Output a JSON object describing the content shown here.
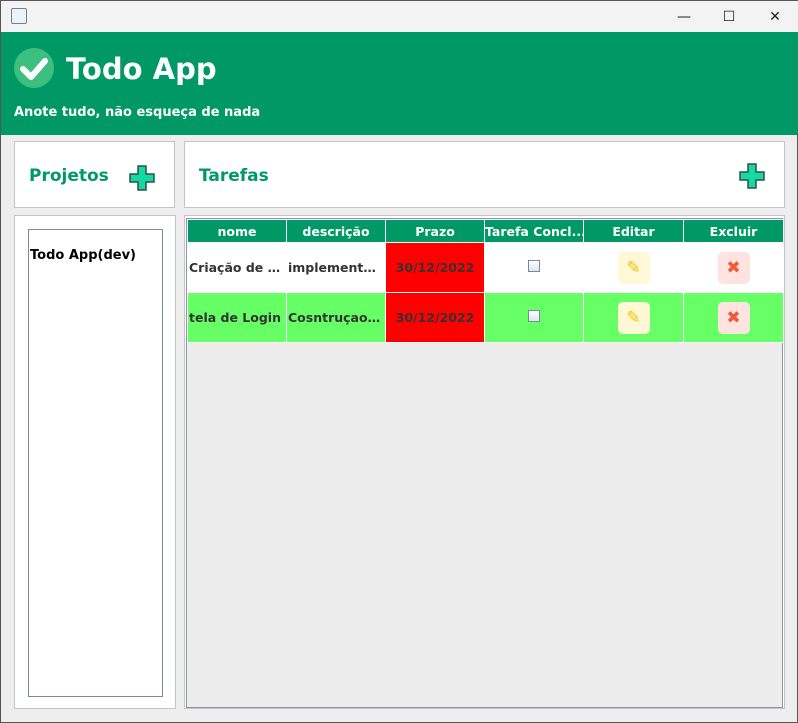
{
  "header": {
    "title": "Todo App",
    "subtitle": "Anote tudo, não esqueça de nada"
  },
  "projects": {
    "title": "Projetos",
    "items": [
      "Todo App(dev)"
    ]
  },
  "tasks": {
    "title": "Tarefas",
    "columns": [
      "nome",
      "descrição",
      "Prazo",
      "Tarefa Concl...",
      "Editar",
      "Excluir"
    ],
    "rows": [
      {
        "nome": "Criação de c...",
        "descricao": "implementa...",
        "prazo": "30/12/2022",
        "done": false,
        "bg": "#ffffff"
      },
      {
        "nome": "tela de Login",
        "descricao": "Cosntruçao ...",
        "prazo": "30/12/2022",
        "done": false,
        "bg": "#66ff66"
      }
    ]
  },
  "colors": {
    "brand": "#009966",
    "overdue": "#ff0000",
    "edit_bg": "#fff8d6",
    "delete_bg": "#ffe3e0"
  }
}
